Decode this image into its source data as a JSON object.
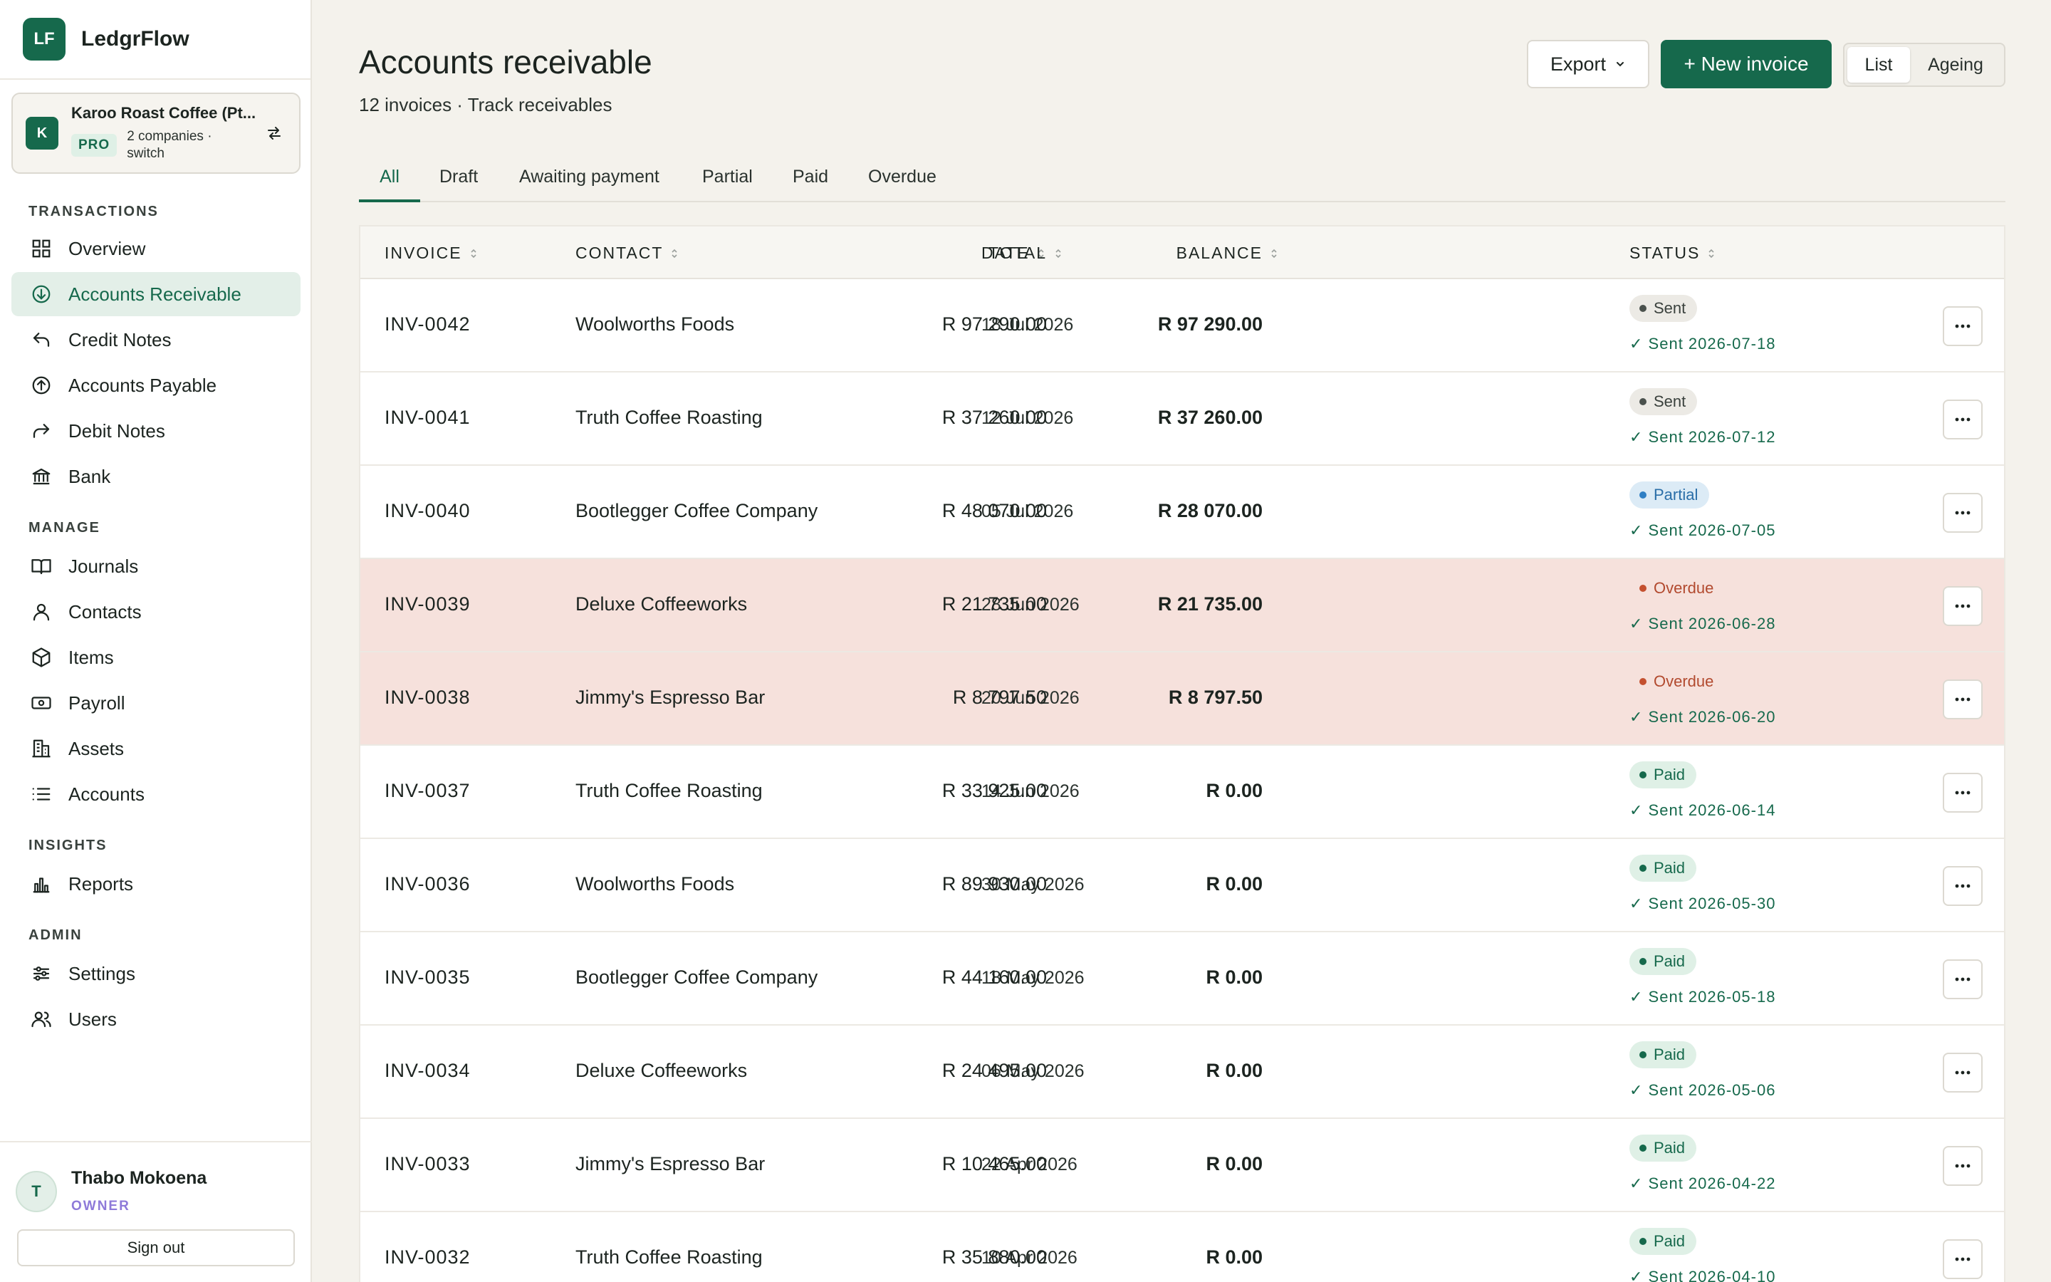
{
  "brand": {
    "logo": "LF",
    "name": "LedgrFlow"
  },
  "company": {
    "avatar": "K",
    "name": "Karoo Roast Coffee (Pt...",
    "plan": "PRO",
    "switch_text": "2 companies · switch",
    "switch_icon": "switch-arrows-icon"
  },
  "nav": {
    "transactions_label": "TRANSACTIONS",
    "manage_label": "MANAGE",
    "insights_label": "INSIGHTS",
    "admin_label": "ADMIN",
    "items": [
      {
        "label": "Overview",
        "icon": "grid-icon"
      },
      {
        "label": "Accounts Receivable",
        "icon": "arrow-down-circle-icon"
      },
      {
        "label": "Credit Notes",
        "icon": "undo-arrow-icon"
      },
      {
        "label": "Accounts Payable",
        "icon": "arrow-up-circle-icon"
      },
      {
        "label": "Debit Notes",
        "icon": "redo-arrow-icon"
      },
      {
        "label": "Bank",
        "icon": "bank-icon"
      },
      {
        "label": "Journals",
        "icon": "book-icon"
      },
      {
        "label": "Contacts",
        "icon": "person-icon"
      },
      {
        "label": "Items",
        "icon": "box-icon"
      },
      {
        "label": "Payroll",
        "icon": "banknote-icon"
      },
      {
        "label": "Assets",
        "icon": "building-icon"
      },
      {
        "label": "Accounts",
        "icon": "list-icon"
      },
      {
        "label": "Reports",
        "icon": "bar-chart-icon"
      },
      {
        "label": "Settings",
        "icon": "sliders-icon"
      },
      {
        "label": "Users",
        "icon": "users-icon"
      }
    ]
  },
  "user": {
    "initial": "T",
    "name": "Thabo Mokoena",
    "role": "OWNER",
    "signout": "Sign out"
  },
  "header": {
    "title": "Accounts receivable",
    "subtitle": "12 invoices · Track receivables",
    "export_label": "Export",
    "new_invoice_label": "+ New invoice",
    "view_list": "List",
    "view_ageing": "Ageing"
  },
  "tabs": [
    "All",
    "Draft",
    "Awaiting payment",
    "Partial",
    "Paid",
    "Overdue"
  ],
  "table": {
    "columns": [
      "INVOICE",
      "CONTACT",
      "DATE",
      "TOTAL",
      "BALANCE",
      "STATUS"
    ],
    "rows": [
      {
        "invoice": "INV-0042",
        "contact": "Woolworths Foods",
        "date": "18 Jul 2026",
        "total": "R 97 290.00",
        "balance": "R 97 290.00",
        "status": "Sent",
        "note": "✓ Sent 2026-07-18"
      },
      {
        "invoice": "INV-0041",
        "contact": "Truth Coffee Roasting",
        "date": "12 Jul 2026",
        "total": "R 37 260.00",
        "balance": "R 37 260.00",
        "status": "Sent",
        "note": "✓ Sent 2026-07-12"
      },
      {
        "invoice": "INV-0040",
        "contact": "Bootlegger Coffee Company",
        "date": "05 Jul 2026",
        "total": "R 48 070.00",
        "balance": "R 28 070.00",
        "status": "Partial",
        "note": "✓ Sent 2026-07-05"
      },
      {
        "invoice": "INV-0039",
        "contact": "Deluxe Coffeeworks",
        "date": "28 Jun 2026",
        "total": "R 21 735.00",
        "balance": "R 21 735.00",
        "status": "Overdue",
        "note": "✓ Sent 2026-06-28"
      },
      {
        "invoice": "INV-0038",
        "contact": "Jimmy's Espresso Bar",
        "date": "20 Jun 2026",
        "total": "R 8 797.50",
        "balance": "R 8 797.50",
        "status": "Overdue",
        "note": "✓ Sent 2026-06-20"
      },
      {
        "invoice": "INV-0037",
        "contact": "Truth Coffee Roasting",
        "date": "14 Jun 2026",
        "total": "R 33 925.00",
        "balance": "R 0.00",
        "status": "Paid",
        "note": "✓ Sent 2026-06-14"
      },
      {
        "invoice": "INV-0036",
        "contact": "Woolworths Foods",
        "date": "30 May 2026",
        "total": "R 89 930.00",
        "balance": "R 0.00",
        "status": "Paid",
        "note": "✓ Sent 2026-05-30"
      },
      {
        "invoice": "INV-0035",
        "contact": "Bootlegger Coffee Company",
        "date": "18 May 2026",
        "total": "R 44 160.00",
        "balance": "R 0.00",
        "status": "Paid",
        "note": "✓ Sent 2026-05-18"
      },
      {
        "invoice": "INV-0034",
        "contact": "Deluxe Coffeeworks",
        "date": "06 May 2026",
        "total": "R 24 495.00",
        "balance": "R 0.00",
        "status": "Paid",
        "note": "✓ Sent 2026-05-06"
      },
      {
        "invoice": "INV-0033",
        "contact": "Jimmy's Espresso Bar",
        "date": "22 Apr 2026",
        "total": "R 10 465.00",
        "balance": "R 0.00",
        "status": "Paid",
        "note": "✓ Sent 2026-04-22"
      },
      {
        "invoice": "INV-0032",
        "contact": "Truth Coffee Roasting",
        "date": "10 Apr 2026",
        "total": "R 35 880.00",
        "balance": "R 0.00",
        "status": "Paid",
        "note": "✓ Sent 2026-04-10"
      }
    ]
  },
  "colors": {
    "accent": "#16694c",
    "overdue_row": "#f6e1dc",
    "background": "#f4f2ec"
  }
}
